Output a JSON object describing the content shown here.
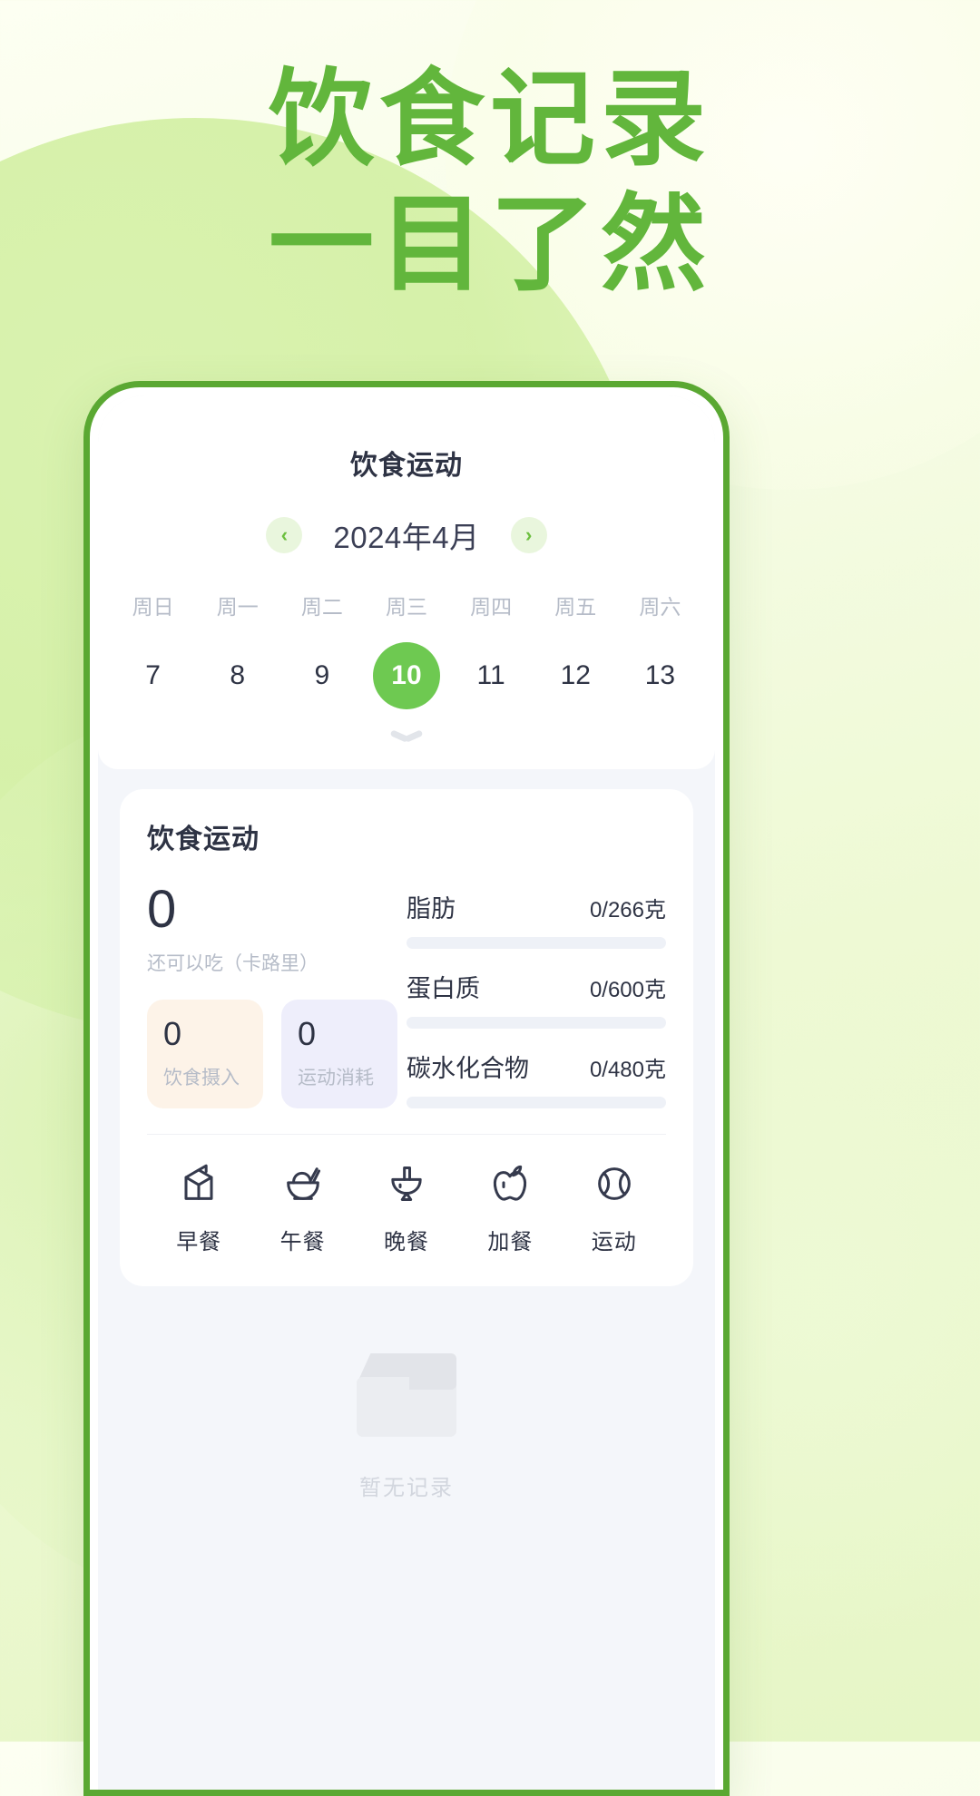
{
  "poster": {
    "headline_line1": "饮食记录",
    "headline_line2": "一目了然",
    "accent_green": "#62b63c",
    "background": "#f6fce6"
  },
  "app": {
    "title": "饮食运动",
    "calendar": {
      "prev_icon": "chevron-left-icon",
      "next_icon": "chevron-right-icon",
      "month_label": "2024年4月",
      "weekdays": [
        "周日",
        "周一",
        "周二",
        "周三",
        "周四",
        "周五",
        "周六"
      ],
      "days": [
        "7",
        "8",
        "9",
        "10",
        "11",
        "12",
        "13"
      ],
      "selected_day": "10",
      "selected_color": "#6ec951",
      "expand_icon": "chevron-down-icon"
    },
    "summary": {
      "card_title": "饮食运动",
      "remaining_value": "0",
      "remaining_label": "还可以吃（卡路里）",
      "mini_stats": [
        {
          "value": "0",
          "label": "饮食摄入",
          "color": "#fdf3e8"
        },
        {
          "value": "0",
          "label": "运动消耗",
          "color": "#eeeefb"
        }
      ],
      "nutrients": [
        {
          "name": "脂肪",
          "value": "0/266克",
          "percent": 0
        },
        {
          "name": "蛋白质",
          "value": "0/600克",
          "percent": 0
        },
        {
          "name": "碳水化合物",
          "value": "0/480克",
          "percent": 0
        }
      ]
    },
    "meals": [
      {
        "label": "早餐",
        "icon": "milk-carton-icon"
      },
      {
        "label": "午餐",
        "icon": "rice-bowl-icon"
      },
      {
        "label": "晚餐",
        "icon": "goblet-bowl-icon"
      },
      {
        "label": "加餐",
        "icon": "apple-icon"
      },
      {
        "label": "运动",
        "icon": "ball-icon"
      }
    ],
    "empty_state": {
      "icon": "empty-box-icon",
      "text": "暂无记录"
    }
  }
}
